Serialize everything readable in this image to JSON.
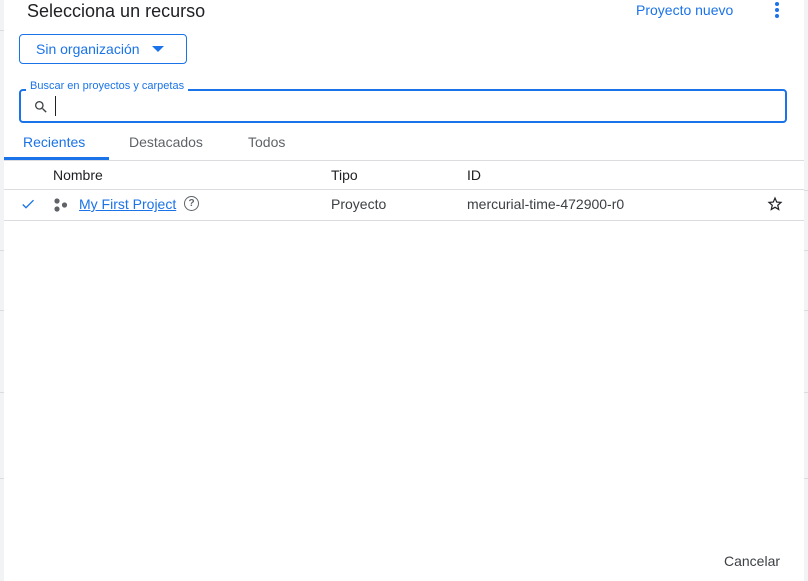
{
  "dialog": {
    "title": "Selecciona un recurso",
    "new_project_label": "Proyecto nuevo",
    "organization_label": "Sin organización",
    "search": {
      "label": "Buscar en proyectos y carpetas",
      "value": ""
    },
    "tabs": [
      {
        "label": "Recientes",
        "active": true
      },
      {
        "label": "Destacados",
        "active": false
      },
      {
        "label": "Todos",
        "active": false
      }
    ],
    "columns": {
      "name": "Nombre",
      "type": "Tipo",
      "id": "ID"
    },
    "rows": [
      {
        "selected": true,
        "name": "My First Project",
        "type": "Proyecto",
        "id": "mercurial-time-472900-r0",
        "starred": false
      }
    ],
    "cancel_label": "Cancelar"
  },
  "colors": {
    "accent": "#1a73e8",
    "text": "#202124",
    "muted": "#5f6368",
    "divider": "#dadce0"
  },
  "icons": [
    "more-vert-icon",
    "caret-down-icon",
    "search-icon",
    "check-icon",
    "project-icon",
    "help-icon",
    "star-outline-icon"
  ]
}
